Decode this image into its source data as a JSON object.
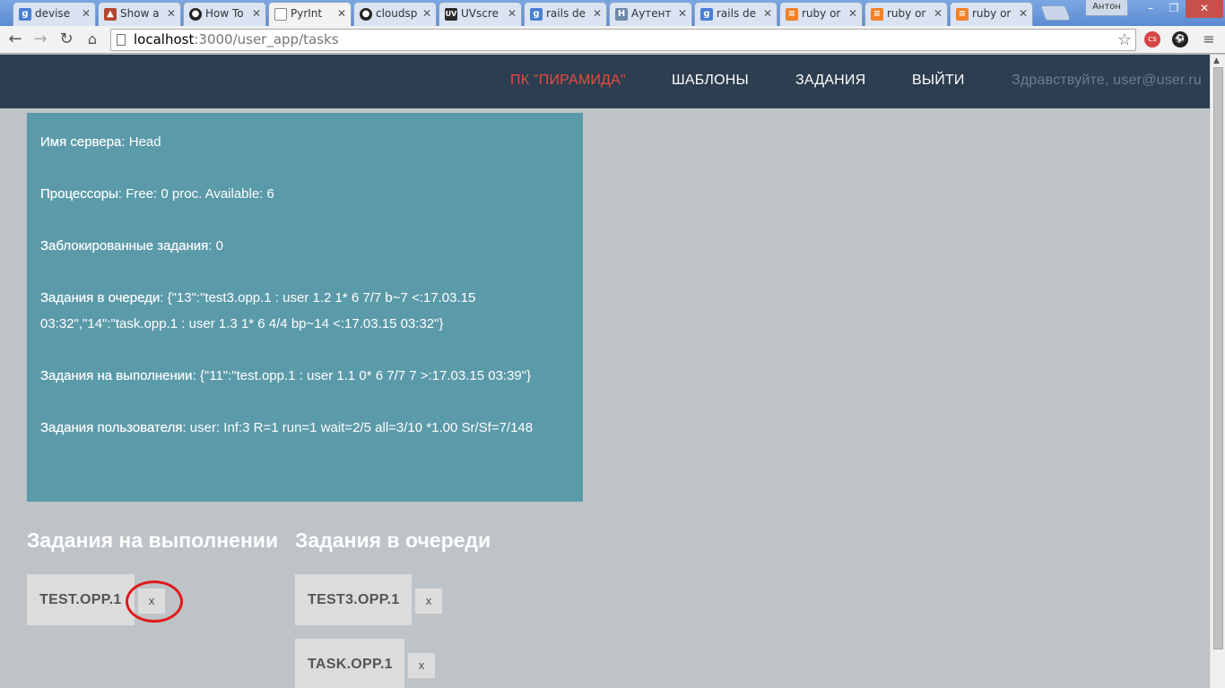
{
  "browser": {
    "tabs": [
      {
        "label": "devise",
        "favicon": "g"
      },
      {
        "label": "Show a",
        "favicon": "img"
      },
      {
        "label": "How To",
        "favicon": "gh"
      },
      {
        "label": "PyrInt",
        "favicon": "page",
        "active": true
      },
      {
        "label": "cloudsp",
        "favicon": "gh"
      },
      {
        "label": "UVscre",
        "favicon": "uv"
      },
      {
        "label": "rails de",
        "favicon": "g"
      },
      {
        "label": "Аутент",
        "favicon": "h"
      },
      {
        "label": "rails de",
        "favicon": "g"
      },
      {
        "label": "ruby or",
        "favicon": "so"
      },
      {
        "label": "ruby or",
        "favicon": "so"
      },
      {
        "label": "ruby or",
        "favicon": "so"
      }
    ],
    "user_badge": "Антон",
    "address": {
      "host": "localhost",
      "path": ":3000/user_app/tasks"
    },
    "window_buttons": {
      "minimize": "–",
      "restore": "❐",
      "close": "✕"
    }
  },
  "navbar": {
    "brand": "ПК \"ПИРАМИДА\"",
    "links": [
      "ШАБЛОНЫ",
      "ЗАДАНИЯ",
      "ВЫЙТИ"
    ],
    "greeting": "Здравствуйте, user@user.ru"
  },
  "info": {
    "server": {
      "label": "Имя сервера",
      "value": ": Head"
    },
    "cpu": {
      "label": "Процессоры",
      "value": ": Free: 0 proc. Available: 6"
    },
    "blocked": {
      "label": "Заблокированные задания",
      "value": ": 0"
    },
    "queued": {
      "label": "Задания в очереди",
      "value": ": {\"13\":\"test3.opp.1 : user 1.2 1* 6 7/7 b~7 <:17.03.15 03:32\",\"14\":\"task.opp.1 : user 1.3 1* 6 4/4 bp~14 <:17.03.15 03:32\"}"
    },
    "running": {
      "label": "Задания на выполнении",
      "value": ": {\"11\":\"test.opp.1 : user 1.1 0* 6 7/7 7 >:17.03.15 03:39\"}"
    },
    "user_tasks": {
      "label": "Задания пользователя",
      "value": ": user: Inf:3 R=1 run=1 wait=2/5 all=3/10 *1.00 Sr/Sf=7/148"
    }
  },
  "running_column": {
    "title": "Задания на выполнении",
    "tasks": [
      {
        "name": "TEST.OPP.1",
        "remove": "x"
      }
    ]
  },
  "queue_column": {
    "title": "Задания в очереди",
    "tasks": [
      {
        "name": "TEST3.OPP.1",
        "remove": "x"
      },
      {
        "name": "TASK.OPP.1",
        "remove": "x"
      }
    ]
  },
  "colors": {
    "navbar": "#2c3e50",
    "brand": "#e74c3c",
    "info_bg": "#5b9aa9",
    "page_bg": "#bdc3c7",
    "highlight": "#e01a1a"
  }
}
